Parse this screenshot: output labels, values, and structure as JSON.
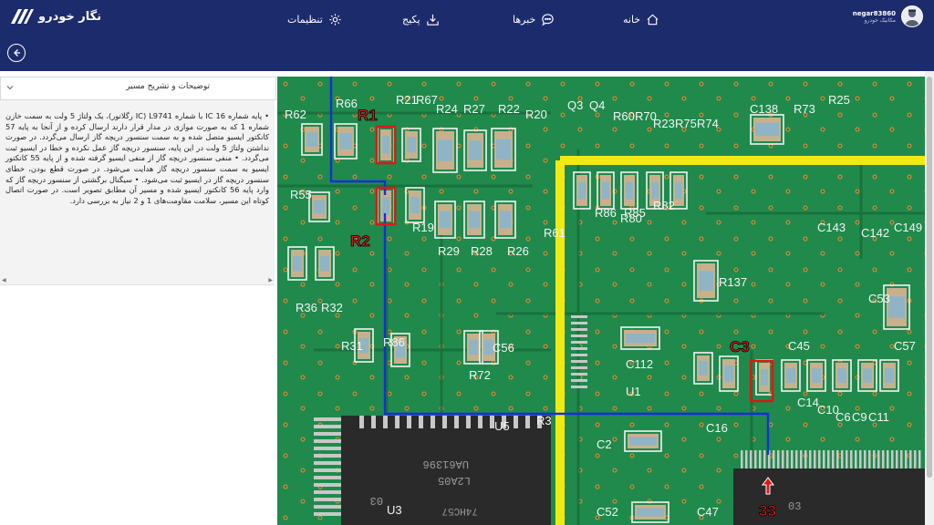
{
  "header": {
    "logo_text": "نگار خودرو",
    "nav": [
      {
        "label": "خانه",
        "icon": "home-icon"
      },
      {
        "label": "خبرها",
        "icon": "chat-icon"
      },
      {
        "label": "پکیج",
        "icon": "download-icon"
      },
      {
        "label": "تنظیمات",
        "icon": "gear-icon"
      }
    ],
    "user": {
      "name": "negar83860",
      "role": "مکانیک خودرو"
    }
  },
  "panel": {
    "title": "توضیحات و تشریح مسیر",
    "description": "• پایه شماره 16 IC با شماره L9741 (IC رگلاتور)، یک ولتاژ 5 ولت به سمت خازن شماره 1 که به صورت موازی در مدار قرار دارند ارسال کرده و از آنجا به پایه 57 کانکتور ایسیو متصل شده و به سمت سنسور دریچه گاز ارسال می‌گردد. در صورت نداشتن ولتاژ 5 ولت در این پایه، سنسور دریچه گاز عمل نکرده و خطا در ایسیو ثبت می‌گردد. • منفی سنسور دریچه گاز از منفی ایسیو گرفته شده و از پایه 55 کانکتور ایسیو به سمت سنسور دریچه گاز هدایت می‌شود. در صورت قطع بودن، خطای سنسور دریچه گاز در ایسیو ثبت می‌شود. • سیگنال برگشتی از سنسور دریچه گاز که وارد پایه 56 کانکتور ایسیو شده و مسیر آن مطابق تصویر است. در صورت اتصال کوتاه این مسیر، سلامت مقاومت‌های 1 و 2 نیاز به بررسی دارد."
  },
  "board": {
    "component_labels": [
      "R62",
      "R66",
      "R21",
      "R67",
      "R24",
      "R27",
      "R22",
      "R20",
      "Q3",
      "Q4",
      "R60",
      "R70",
      "R23",
      "R75",
      "R74",
      "C138",
      "R73",
      "R25",
      "R55",
      "R19",
      "R29",
      "R28",
      "R26",
      "R61",
      "R86",
      "R85",
      "R82",
      "R80",
      "C143",
      "C142",
      "C149",
      "R137",
      "C53",
      "C112",
      "R36",
      "R32",
      "R31",
      "R86",
      "C56",
      "R72",
      "C45",
      "C57",
      "U1",
      "C6",
      "C10",
      "C14",
      "C9",
      "C11",
      "C16",
      "U5",
      "R3",
      "C2",
      "C52",
      "C47",
      "U3"
    ],
    "callouts": [
      "R1",
      "R2",
      "C3",
      "33"
    ],
    "chip_text": [
      "UA61396",
      "L2A05",
      "03",
      "74HC57"
    ]
  },
  "colors": {
    "header": "#1c2b6b",
    "pcb": "#1f8a4c",
    "highlight": "#e01616",
    "trace": "#1530d8",
    "zone": "#f0ea12"
  }
}
